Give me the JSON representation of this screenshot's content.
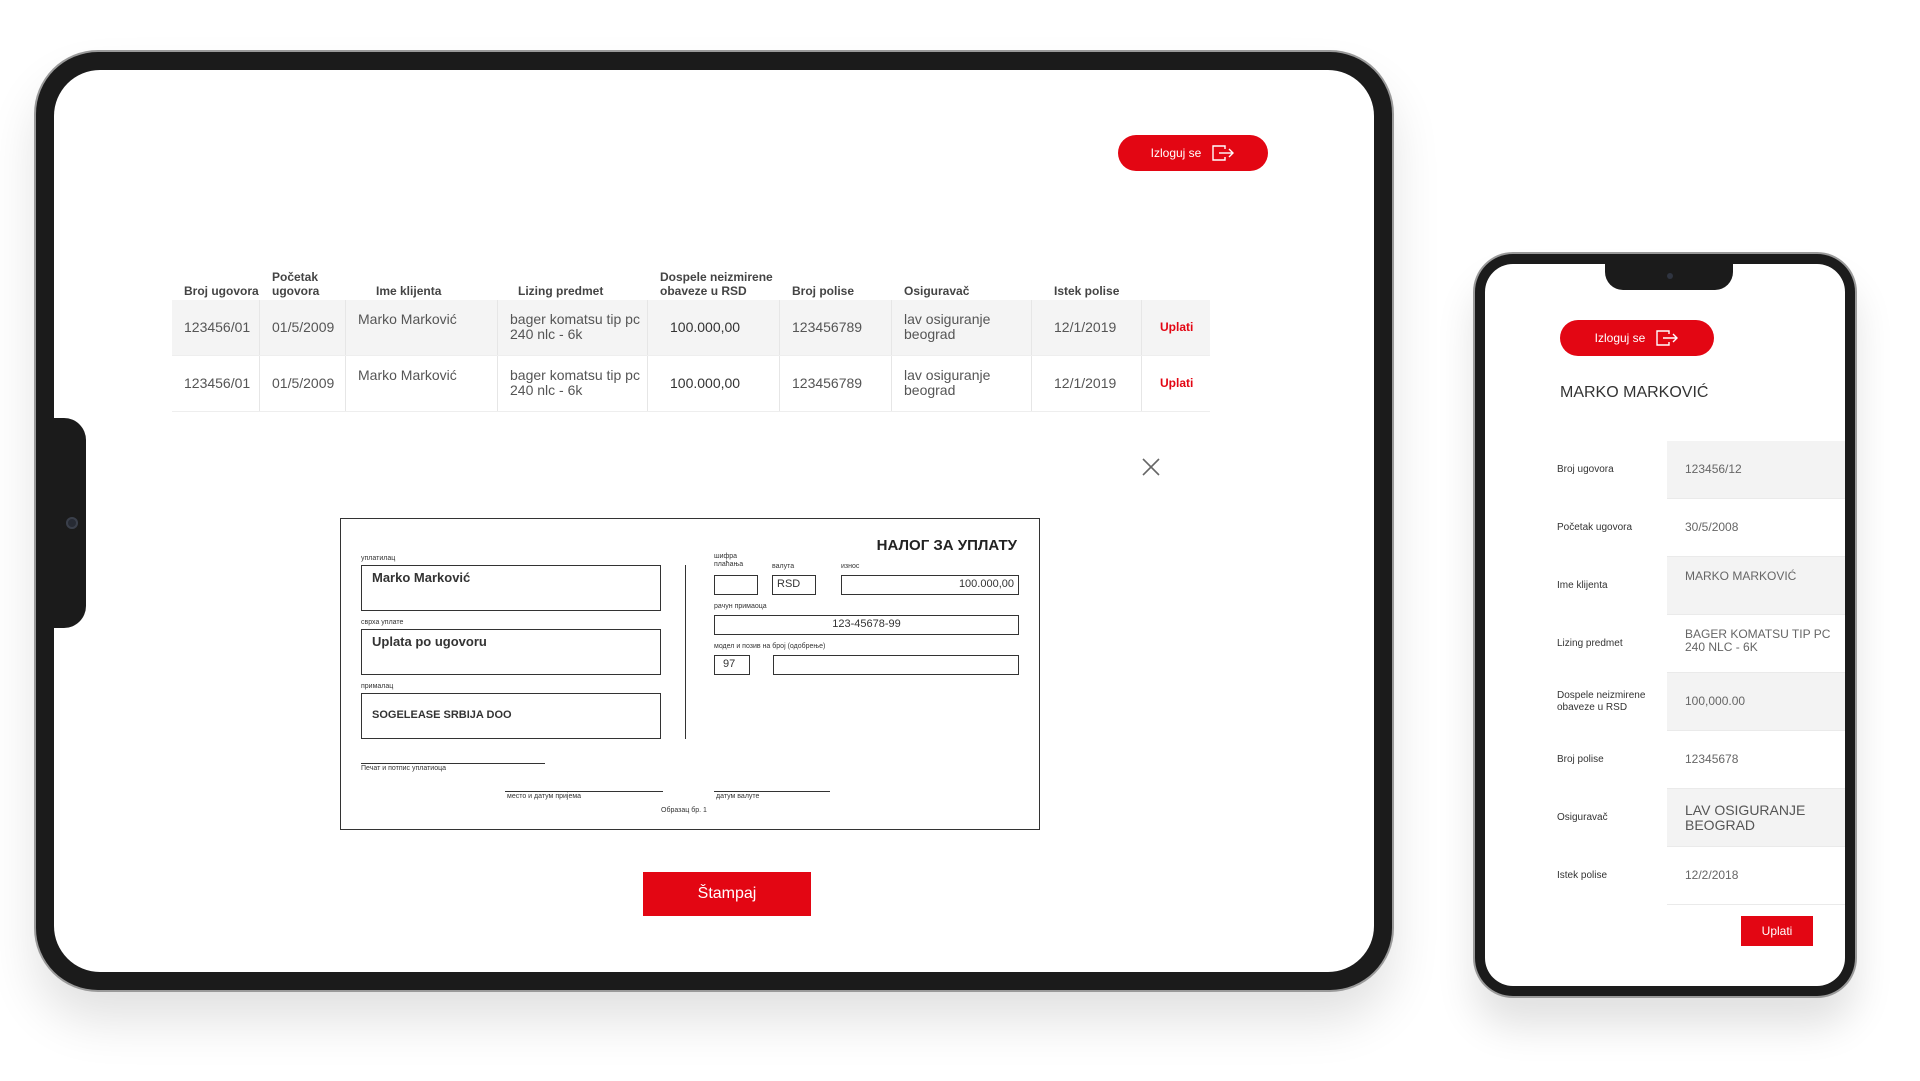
{
  "colors": {
    "accent": "#e30613",
    "text": "#333333",
    "row_shade": "#f4f4f4"
  },
  "tablet": {
    "logout": {
      "label": "Izloguj se",
      "icon": "logout-icon"
    },
    "table": {
      "headers": [
        "Broj ugovora",
        "Početak ugovora",
        "Ime klijenta",
        "Lizing predmet",
        "Dospele neizmirene obaveze u RSD",
        "Broj polise",
        "Osiguravač",
        "Istek polise"
      ],
      "rows": [
        {
          "contract_no": "123456/01",
          "start": "01/5/2009",
          "client": "Marko Marković",
          "subject": "bager komatsu tip pc 240 nlc - 6k",
          "due": "100.000,00",
          "policy_no": "123456789",
          "insurer": "lav osiguranje beograd",
          "expiry": "12/1/2019",
          "action": "Uplati"
        },
        {
          "contract_no": "123456/01",
          "start": "01/5/2009",
          "client": "Marko Marković",
          "subject": "bager komatsu tip pc 240 nlc - 6k",
          "due": "100.000,00",
          "policy_no": "123456789",
          "insurer": "lav osiguranje beograd",
          "expiry": "12/1/2019",
          "action": "Uplati"
        }
      ]
    },
    "close_icon": "close-icon",
    "slip": {
      "title": "НАЛОГ ЗА УПЛАТУ",
      "payer_label": "уплатилац",
      "payer": "Marko Marković",
      "purpose_label": "сврха уплате",
      "purpose": "Uplata po ugovoru",
      "recipient_label": "прималац",
      "recipient": "SOGELEASE SRBIJA DOO",
      "code_label": "шифра плаћања",
      "currency_label": "валута",
      "currency": "RSD",
      "amount_label": "износ",
      "amount": "100.000,00",
      "account_label": "рачун примаоца",
      "account": "123-45678-99",
      "model_label": "модел и позив на број (одобрење)",
      "model": "97",
      "signature_label": "Печат и потпис уплатиоца",
      "place_date_label": "место и датум пријема",
      "value_date_label": "датум валуте",
      "form_label": "Образац бр. 1"
    },
    "print_label": "Štampaj"
  },
  "phone": {
    "logout": {
      "label": "Izloguj se",
      "icon": "logout-icon"
    },
    "client_name": "MARKO MARKOVIĆ",
    "details": [
      {
        "label": "Broj ugovora",
        "value": "123456/12"
      },
      {
        "label": "Početak ugovora",
        "value": "30/5/2008"
      },
      {
        "label": "Ime klijenta",
        "value": "MARKO MARKOVIĆ"
      },
      {
        "label": "Lizing predmet",
        "value": "BAGER KOMATSU TIP PC 240 NLC - 6K"
      },
      {
        "label": "Dospele neizmirene obaveze u RSD",
        "value": "100,000.00"
      },
      {
        "label": "Broj polise",
        "value": "12345678"
      },
      {
        "label": "Osiguravač",
        "value": "LAV OSIGURANJE BEOGRAD"
      },
      {
        "label": "Istek polise",
        "value": "12/2/2018"
      }
    ],
    "pay_label": "Uplati"
  }
}
